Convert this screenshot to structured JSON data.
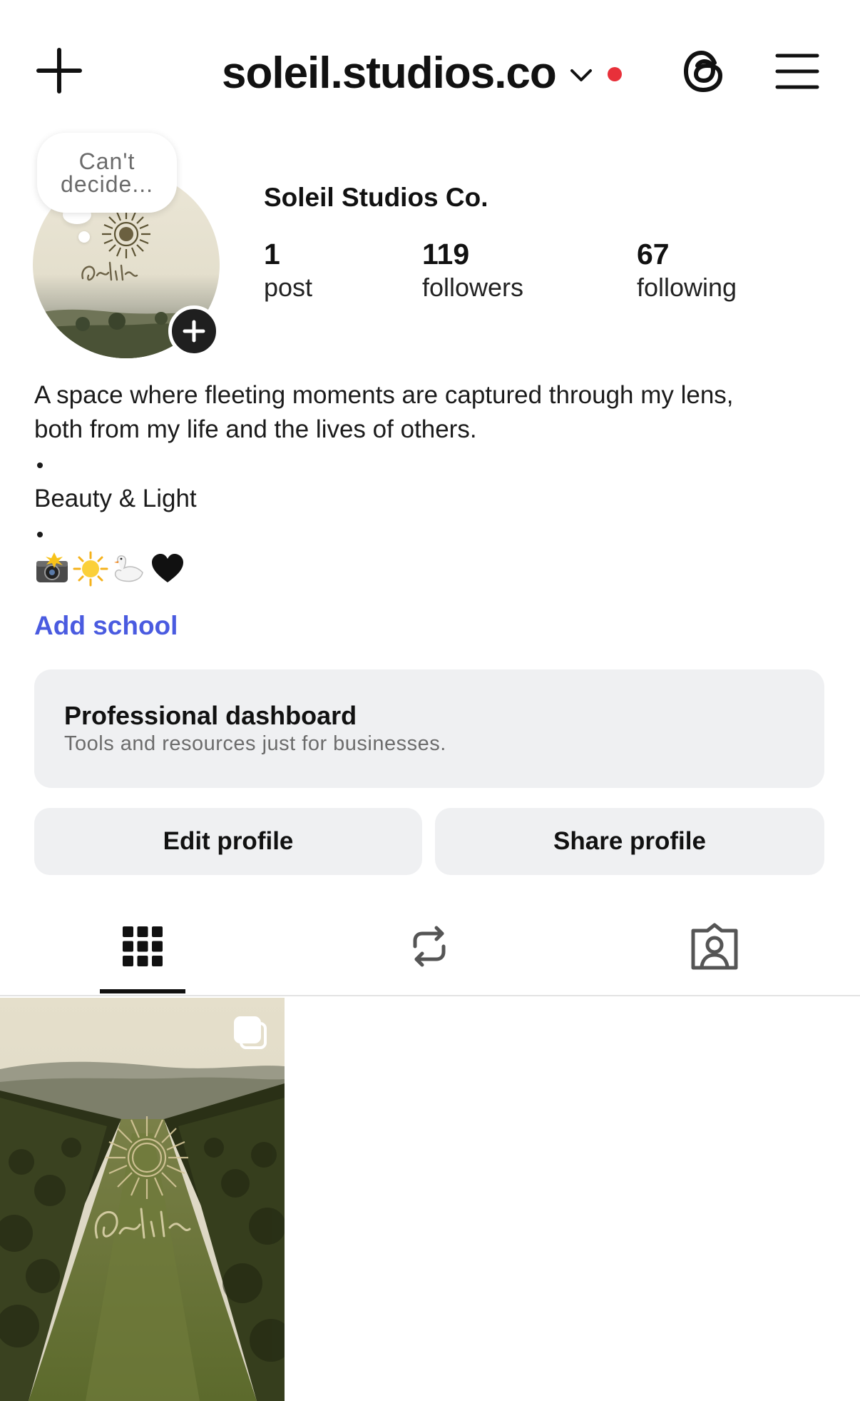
{
  "header": {
    "username": "soleil.studios.co",
    "icons": {
      "create": "plus-icon",
      "switch_account": "chevron-down-icon",
      "threads": "threads-icon",
      "menu": "hamburger-menu-icon"
    },
    "notification_dot_color": "#e8303a"
  },
  "profile": {
    "note": "Can't decide...",
    "display_name": "Soleil Studios Co.",
    "stats": {
      "posts": {
        "count": "1",
        "label": "post"
      },
      "followers": {
        "count": "119",
        "label": "followers"
      },
      "following": {
        "count": "67",
        "label": "following"
      }
    },
    "bio": {
      "line1": "A space where fleeting moments are captured through my lens,",
      "line2": "both from my life and the lives of others.",
      "tagline": "Beauty & Light",
      "emojis": [
        "camera-flash-emoji",
        "sun-emoji",
        "swan-emoji",
        "black-heart-emoji"
      ]
    },
    "add_school": "Add school"
  },
  "pro_dashboard": {
    "title": "Professional dashboard",
    "subtitle": "Tools and resources just for businesses."
  },
  "actions": {
    "edit": "Edit profile",
    "share": "Share profile"
  },
  "tabs": [
    {
      "name": "posts-grid",
      "icon": "grid-icon",
      "active": true
    },
    {
      "name": "reposts",
      "icon": "repost-icon",
      "active": false
    },
    {
      "name": "tagged",
      "icon": "tagged-person-icon",
      "active": false
    }
  ],
  "posts": [
    {
      "type": "carousel",
      "icon": "multiple-posts-icon"
    }
  ],
  "colors": {
    "link": "#4a5be0",
    "card_bg": "#eff0f2",
    "text": "#111111"
  }
}
